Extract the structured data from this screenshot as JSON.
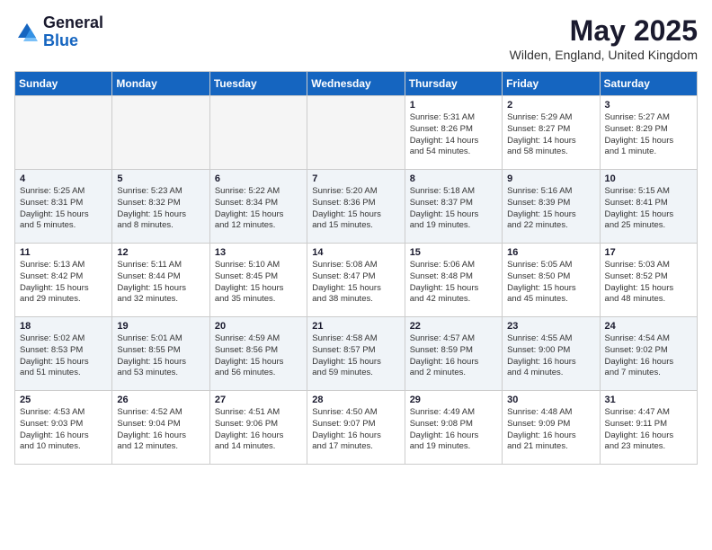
{
  "logo": {
    "general": "General",
    "blue": "Blue"
  },
  "title": "May 2025",
  "location": "Wilden, England, United Kingdom",
  "days_of_week": [
    "Sunday",
    "Monday",
    "Tuesday",
    "Wednesday",
    "Thursday",
    "Friday",
    "Saturday"
  ],
  "weeks": [
    [
      {
        "num": "",
        "info": ""
      },
      {
        "num": "",
        "info": ""
      },
      {
        "num": "",
        "info": ""
      },
      {
        "num": "",
        "info": ""
      },
      {
        "num": "1",
        "info": "Sunrise: 5:31 AM\nSunset: 8:26 PM\nDaylight: 14 hours\nand 54 minutes."
      },
      {
        "num": "2",
        "info": "Sunrise: 5:29 AM\nSunset: 8:27 PM\nDaylight: 14 hours\nand 58 minutes."
      },
      {
        "num": "3",
        "info": "Sunrise: 5:27 AM\nSunset: 8:29 PM\nDaylight: 15 hours\nand 1 minute."
      }
    ],
    [
      {
        "num": "4",
        "info": "Sunrise: 5:25 AM\nSunset: 8:31 PM\nDaylight: 15 hours\nand 5 minutes."
      },
      {
        "num": "5",
        "info": "Sunrise: 5:23 AM\nSunset: 8:32 PM\nDaylight: 15 hours\nand 8 minutes."
      },
      {
        "num": "6",
        "info": "Sunrise: 5:22 AM\nSunset: 8:34 PM\nDaylight: 15 hours\nand 12 minutes."
      },
      {
        "num": "7",
        "info": "Sunrise: 5:20 AM\nSunset: 8:36 PM\nDaylight: 15 hours\nand 15 minutes."
      },
      {
        "num": "8",
        "info": "Sunrise: 5:18 AM\nSunset: 8:37 PM\nDaylight: 15 hours\nand 19 minutes."
      },
      {
        "num": "9",
        "info": "Sunrise: 5:16 AM\nSunset: 8:39 PM\nDaylight: 15 hours\nand 22 minutes."
      },
      {
        "num": "10",
        "info": "Sunrise: 5:15 AM\nSunset: 8:41 PM\nDaylight: 15 hours\nand 25 minutes."
      }
    ],
    [
      {
        "num": "11",
        "info": "Sunrise: 5:13 AM\nSunset: 8:42 PM\nDaylight: 15 hours\nand 29 minutes."
      },
      {
        "num": "12",
        "info": "Sunrise: 5:11 AM\nSunset: 8:44 PM\nDaylight: 15 hours\nand 32 minutes."
      },
      {
        "num": "13",
        "info": "Sunrise: 5:10 AM\nSunset: 8:45 PM\nDaylight: 15 hours\nand 35 minutes."
      },
      {
        "num": "14",
        "info": "Sunrise: 5:08 AM\nSunset: 8:47 PM\nDaylight: 15 hours\nand 38 minutes."
      },
      {
        "num": "15",
        "info": "Sunrise: 5:06 AM\nSunset: 8:48 PM\nDaylight: 15 hours\nand 42 minutes."
      },
      {
        "num": "16",
        "info": "Sunrise: 5:05 AM\nSunset: 8:50 PM\nDaylight: 15 hours\nand 45 minutes."
      },
      {
        "num": "17",
        "info": "Sunrise: 5:03 AM\nSunset: 8:52 PM\nDaylight: 15 hours\nand 48 minutes."
      }
    ],
    [
      {
        "num": "18",
        "info": "Sunrise: 5:02 AM\nSunset: 8:53 PM\nDaylight: 15 hours\nand 51 minutes."
      },
      {
        "num": "19",
        "info": "Sunrise: 5:01 AM\nSunset: 8:55 PM\nDaylight: 15 hours\nand 53 minutes."
      },
      {
        "num": "20",
        "info": "Sunrise: 4:59 AM\nSunset: 8:56 PM\nDaylight: 15 hours\nand 56 minutes."
      },
      {
        "num": "21",
        "info": "Sunrise: 4:58 AM\nSunset: 8:57 PM\nDaylight: 15 hours\nand 59 minutes."
      },
      {
        "num": "22",
        "info": "Sunrise: 4:57 AM\nSunset: 8:59 PM\nDaylight: 16 hours\nand 2 minutes."
      },
      {
        "num": "23",
        "info": "Sunrise: 4:55 AM\nSunset: 9:00 PM\nDaylight: 16 hours\nand 4 minutes."
      },
      {
        "num": "24",
        "info": "Sunrise: 4:54 AM\nSunset: 9:02 PM\nDaylight: 16 hours\nand 7 minutes."
      }
    ],
    [
      {
        "num": "25",
        "info": "Sunrise: 4:53 AM\nSunset: 9:03 PM\nDaylight: 16 hours\nand 10 minutes."
      },
      {
        "num": "26",
        "info": "Sunrise: 4:52 AM\nSunset: 9:04 PM\nDaylight: 16 hours\nand 12 minutes."
      },
      {
        "num": "27",
        "info": "Sunrise: 4:51 AM\nSunset: 9:06 PM\nDaylight: 16 hours\nand 14 minutes."
      },
      {
        "num": "28",
        "info": "Sunrise: 4:50 AM\nSunset: 9:07 PM\nDaylight: 16 hours\nand 17 minutes."
      },
      {
        "num": "29",
        "info": "Sunrise: 4:49 AM\nSunset: 9:08 PM\nDaylight: 16 hours\nand 19 minutes."
      },
      {
        "num": "30",
        "info": "Sunrise: 4:48 AM\nSunset: 9:09 PM\nDaylight: 16 hours\nand 21 minutes."
      },
      {
        "num": "31",
        "info": "Sunrise: 4:47 AM\nSunset: 9:11 PM\nDaylight: 16 hours\nand 23 minutes."
      }
    ]
  ]
}
